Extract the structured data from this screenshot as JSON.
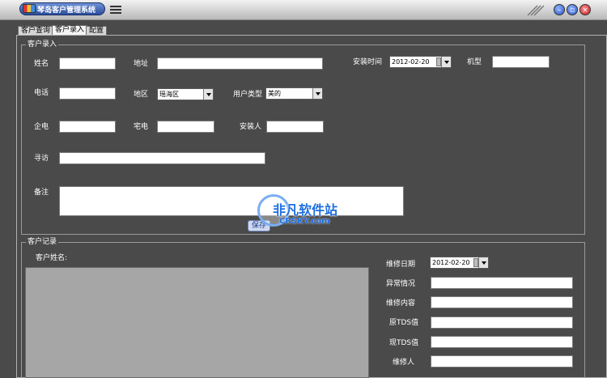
{
  "window": {
    "title": "琴岛客户管理系统"
  },
  "tabs": [
    "客户查询",
    "客户录入",
    "配置"
  ],
  "entry": {
    "group_title": "客户录入",
    "name_label": "姓名",
    "address_label": "地址",
    "install_time_label": "安装时间",
    "install_time_value": "2012-02-20",
    "model_label": "机型",
    "phone_label": "电话",
    "region_label": "地区",
    "region_value": "瑶海区",
    "user_type_label": "用户类型",
    "user_type_value": "美的",
    "company_phone_label": "企电",
    "home_phone_label": "宅电",
    "installer_label": "安装人",
    "visit_label": "寻访",
    "notes_label": "备注",
    "save_label": "保存"
  },
  "records": {
    "group_title": "客户记录",
    "customer_name_label": "客户姓名:",
    "repair_date_label": "维修日期",
    "repair_date_value": "2012-02-20",
    "abnormal_label": "异常情况",
    "repair_content_label": "维修内容",
    "orig_tds_label": "原TDS值",
    "curr_tds_label": "现TDS值",
    "repairer_label": "维修人"
  },
  "watermark": {
    "brand": "非凡软件站",
    "sub": "CRSKY.com"
  }
}
